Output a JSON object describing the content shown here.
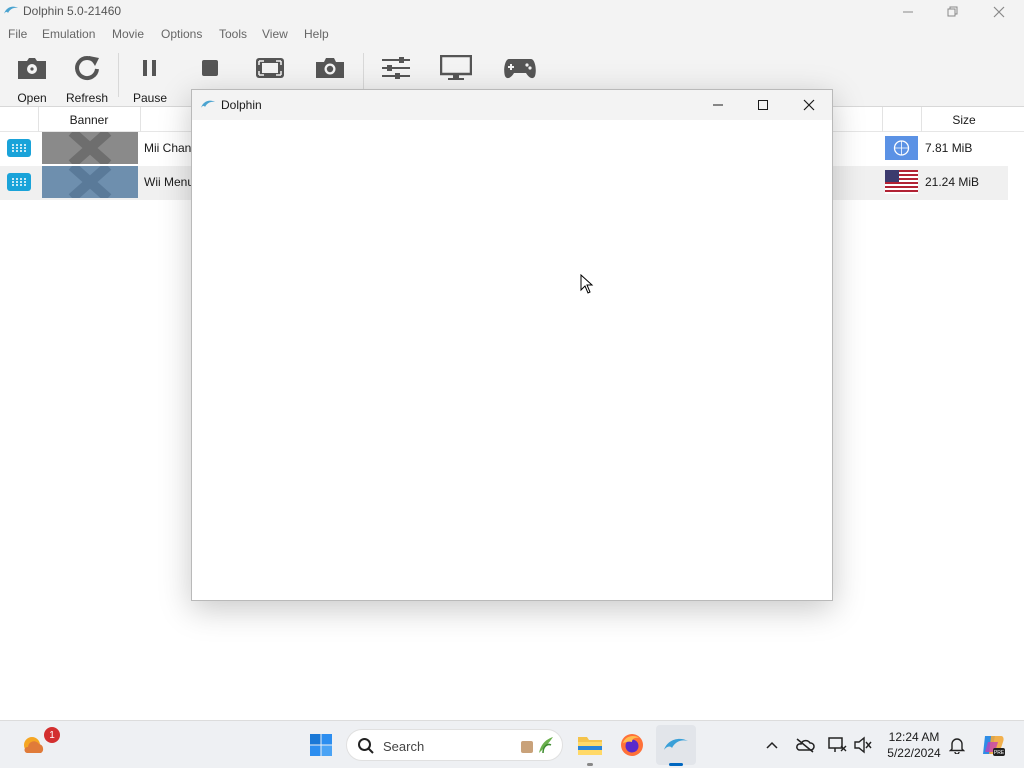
{
  "window": {
    "title": "Dolphin 5.0-21460"
  },
  "menu": [
    "File",
    "Emulation",
    "Movie",
    "Options",
    "Tools",
    "View",
    "Help"
  ],
  "toolbar": {
    "open_label": "Open",
    "refresh_label": "Refresh",
    "pause_label": "Pause"
  },
  "list": {
    "headers": {
      "banner": "Banner",
      "size": "Size"
    },
    "rows": [
      {
        "name": "Mii Chan",
        "size": "7.81 MiB",
        "region_icon": "un-flag-icon"
      },
      {
        "name": "Wii Menu",
        "size": "21.24 MiB",
        "region_icon": "us-flag-icon"
      }
    ]
  },
  "popup": {
    "title": "Dolphin"
  },
  "taskbar": {
    "search_placeholder": "Search",
    "weather_badge": "1",
    "time": "12:24 AM",
    "date": "5/22/2024"
  },
  "colors": {
    "accent": "#0067c0",
    "platform_icon": "#1aa3d9"
  }
}
